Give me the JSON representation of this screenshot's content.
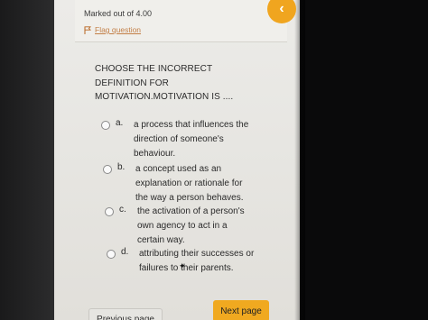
{
  "header": {
    "marked": "Marked out of 4.00",
    "flag_label": "Flag question",
    "back_label": "‹"
  },
  "question": {
    "text": "CHOOSE THE INCORRECT\nDEFINITION FOR\nMOTIVATION.MOTIVATION IS ...."
  },
  "options": [
    {
      "letter": "a.",
      "text": "a process that influences the\ndirection of someone's\nbehaviour."
    },
    {
      "letter": "b.",
      "text": "a concept used as an\nexplanation or rationale for\nthe way a person behaves."
    },
    {
      "letter": "c.",
      "text": "the activation of a person's\nown agency to act in a\ncertain way."
    },
    {
      "letter": "d.",
      "text": "attributing their successes or\nfailures to their parents."
    }
  ],
  "footer": {
    "prev_label": "Previous page",
    "next_label": "Next page"
  },
  "colors": {
    "accent": "#f0a920",
    "flag": "#b8641f"
  }
}
